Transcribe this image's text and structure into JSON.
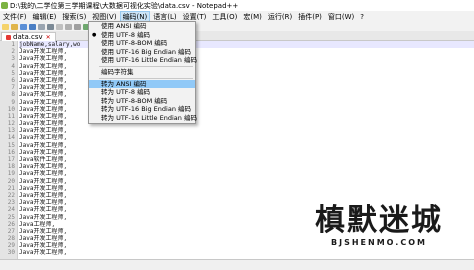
{
  "window": {
    "title": "D:\\我的\\二学位第三学期课程\\大数据可视化实验\\data.csv - Notepad++"
  },
  "menubar": {
    "items": [
      {
        "label": "文件(F)"
      },
      {
        "label": "编辑(E)"
      },
      {
        "label": "搜索(S)"
      },
      {
        "label": "视图(V)"
      },
      {
        "label": "编码(N)"
      },
      {
        "label": "语言(L)"
      },
      {
        "label": "设置(T)"
      },
      {
        "label": "工具(O)"
      },
      {
        "label": "宏(M)"
      },
      {
        "label": "运行(R)"
      },
      {
        "label": "插件(P)"
      },
      {
        "label": "窗口(W)"
      },
      {
        "label": "?"
      }
    ],
    "active_index": 4
  },
  "tab": {
    "label": "data.csv"
  },
  "encoding_menu": {
    "items": [
      {
        "label": "使用 ANSI 编码",
        "checked": false
      },
      {
        "label": "使用 UTF-8 编码",
        "checked": true
      },
      {
        "label": "使用 UTF-8-BOM 编码",
        "checked": false
      },
      {
        "label": "使用 UTF-16 Big Endian 编码",
        "checked": false
      },
      {
        "label": "使用 UTF-16 Little Endian 编码",
        "checked": false
      },
      {
        "label": "编码字符集",
        "checked": false
      },
      {
        "label": "转为 ANSI 编码",
        "checked": false,
        "highlight": true
      },
      {
        "label": "转为 UTF-8 编码",
        "checked": false
      },
      {
        "label": "转为 UTF-8-BOM 编码",
        "checked": false
      },
      {
        "label": "转为 UTF-16 Big Endian 编码",
        "checked": false
      },
      {
        "label": "转为 UTF-16 Little Endian 编码",
        "checked": false
      }
    ]
  },
  "editor": {
    "line_numbers": [
      "1",
      "2",
      "3",
      "4",
      "5",
      "6",
      "7",
      "8",
      "9",
      "10",
      "11",
      "12",
      "13",
      "14",
      "15",
      "16",
      "17",
      "18",
      "19",
      "20",
      "21",
      "22",
      "23",
      "24",
      "25",
      "26",
      "27",
      "28",
      "29",
      "30"
    ],
    "lines": [
      "jobName,salary,wo",
      "Java开发工程师,",
      "Java开发工程师,",
      "Java开发工程师,",
      "Java开发工程师,",
      "Java开发工程师,",
      "Java开发工程师,",
      "Java开发工程师,",
      "Java开发工程师,",
      "Java开发工程师,",
      "Java开发工程师,",
      "Java开发工程师,",
      "Java开发工程师,",
      "Java开发工程师,",
      "Java开发工程师,",
      "Java开发工程师,",
      "Java软件工程师,",
      "Java开发工程师,",
      "Java开发工程师,",
      "Java开发工程师,",
      "Java开发工程师,",
      "Java开发工程师,",
      "Java开发工程师,",
      "Java开发工程师,",
      "Java开发工程师,",
      "Java工程师,",
      "Java开发工程师,",
      "Java开发工程师,",
      "Java开发工程师,",
      "Java开发工程师,"
    ]
  },
  "watermark": {
    "logo_text": "槙默迷城",
    "sub_text": "BJSHENMO.COM"
  },
  "colors": {
    "menu_highlight": "#91c9f7",
    "current_line": "#e8e8ff"
  }
}
